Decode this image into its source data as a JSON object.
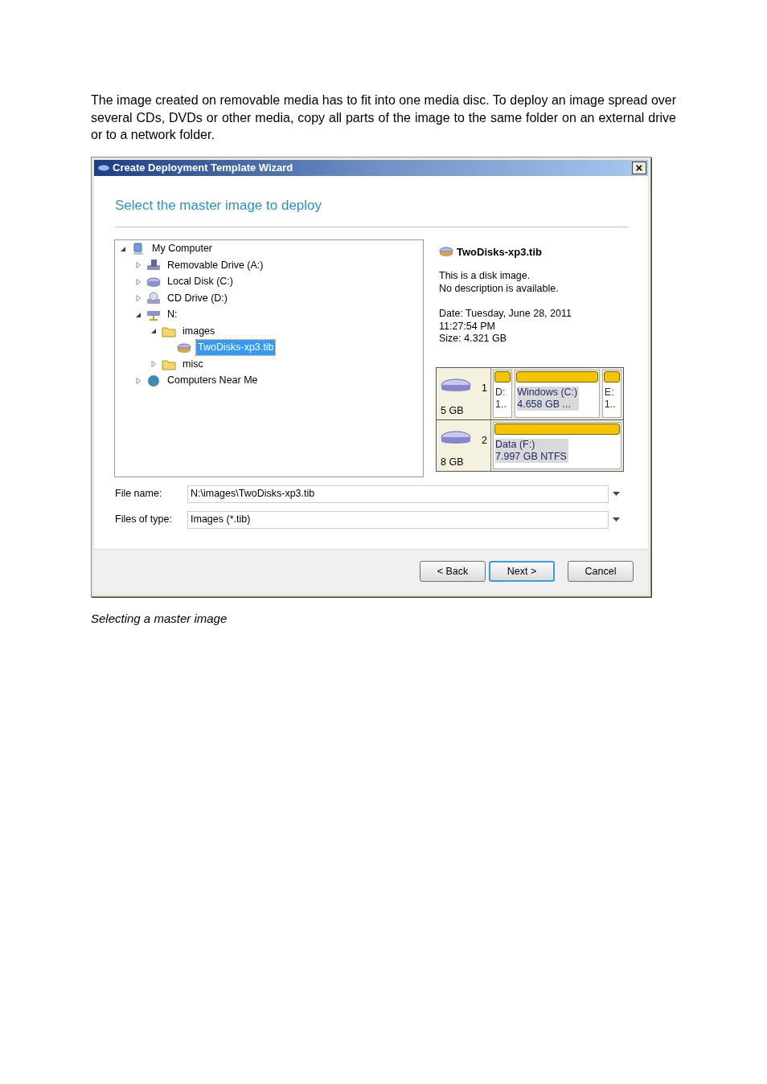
{
  "intro": "The image created on removable media has to fit into one media disc. To deploy an image spread over several CDs, DVDs or other media, copy all parts of the image to the same folder on an external drive or to a network folder.",
  "window": {
    "title": "Create Deployment Template Wizard",
    "close": "×"
  },
  "heading": "Select the master image to deploy",
  "tree": [
    {
      "label": "My Computer",
      "kind": "computer",
      "expanded": true,
      "selected": false,
      "children": [
        {
          "label": "Removable Drive (A:)",
          "kind": "floppy",
          "expanded": false,
          "selected": false
        },
        {
          "label": "Local Disk (C:)",
          "kind": "disk",
          "expanded": false,
          "selected": false
        },
        {
          "label": "CD Drive (D:)",
          "kind": "cd",
          "expanded": false,
          "selected": false
        },
        {
          "label": "N:",
          "kind": "network",
          "expanded": true,
          "selected": false,
          "children": [
            {
              "label": "images",
              "kind": "folder",
              "expanded": true,
              "selected": false,
              "children": [
                {
                  "label": "TwoDisks-xp3.tib",
                  "kind": "image",
                  "selected": true
                }
              ]
            },
            {
              "label": "misc",
              "kind": "folder",
              "expanded": false,
              "selected": false
            }
          ]
        },
        {
          "label": "Computers Near Me",
          "kind": "globe",
          "expanded": false,
          "selected": false
        }
      ]
    }
  ],
  "details": {
    "name": "TwoDisks-xp3.tib",
    "description": [
      "This is a disk image.",
      "No description is available."
    ],
    "info": [
      "Date: Tuesday, June 28, 2011",
      "11:27:54 PM",
      "Size: 4.321 GB"
    ]
  },
  "disks": [
    {
      "number": "1",
      "size": "5 GB",
      "partitions": [
        {
          "lines": [
            "D:",
            "1.."
          ],
          "selected": false
        },
        {
          "lines": [
            "Windows (C:)",
            "4.658 GB  ..."
          ],
          "selected": true
        },
        {
          "lines": [
            "E:",
            "1.."
          ],
          "selected": false
        }
      ]
    },
    {
      "number": "2",
      "size": "8 GB",
      "partitions": [
        {
          "lines": [
            "Data (F:)",
            "7.997 GB  NTFS"
          ],
          "selected": true
        }
      ]
    }
  ],
  "fields": [
    {
      "label": "File name:",
      "value": "N:\\images\\TwoDisks-xp3.tib"
    },
    {
      "label": "Files of type:",
      "value": "Images (*.tib)"
    }
  ],
  "buttons": [
    {
      "label": "< Back",
      "default": false
    },
    {
      "label": "Next >",
      "default": true
    },
    {
      "label": "Cancel",
      "default": false
    }
  ],
  "caption": "Selecting a master image"
}
